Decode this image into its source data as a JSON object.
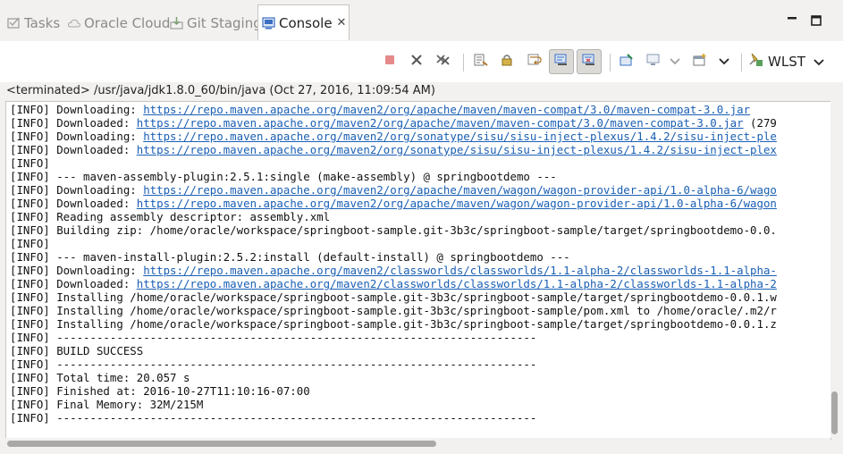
{
  "tabs": [
    {
      "label": "Tasks",
      "icon": "tasks-icon"
    },
    {
      "label": "Oracle Cloud",
      "icon": "cloud-icon"
    },
    {
      "label": "Git Staging",
      "icon": "git-staging-icon"
    },
    {
      "label": "Console",
      "icon": "console-icon",
      "active": true
    }
  ],
  "toolbar": {
    "wlst_label": "WLST",
    "accent_red": "#e05050",
    "accent_blue": "#3a6fc4"
  },
  "process_description": "<terminated> /usr/java/jdk1.8.0_60/bin/java (Oct 27, 2016, 11:09:54 AM)",
  "console": {
    "lines": [
      {
        "prefix": "[INFO] Downloading: ",
        "link": "https://repo.maven.apache.org/maven2/org/apache/maven/maven-compat/3.0/maven-compat-3.0.jar",
        "suffix": ""
      },
      {
        "prefix": "[INFO] Downloaded: ",
        "link": "https://repo.maven.apache.org/maven2/org/apache/maven/maven-compat/3.0/maven-compat-3.0.jar",
        "suffix": " (279"
      },
      {
        "prefix": "[INFO] Downloading: ",
        "link": "https://repo.maven.apache.org/maven2/org/sonatype/sisu/sisu-inject-plexus/1.4.2/sisu-inject-ple",
        "suffix": ""
      },
      {
        "prefix": "[INFO] Downloaded: ",
        "link": "https://repo.maven.apache.org/maven2/org/sonatype/sisu/sisu-inject-plexus/1.4.2/sisu-inject-plex",
        "suffix": ""
      },
      {
        "prefix": "[INFO]",
        "link": "",
        "suffix": ""
      },
      {
        "prefix": "[INFO] --- maven-assembly-plugin:2.5.1:single (make-assembly) @ springbootdemo ---",
        "link": "",
        "suffix": ""
      },
      {
        "prefix": "[INFO] Downloading: ",
        "link": "https://repo.maven.apache.org/maven2/org/apache/maven/wagon/wagon-provider-api/1.0-alpha-6/wago",
        "suffix": ""
      },
      {
        "prefix": "[INFO] Downloaded: ",
        "link": "https://repo.maven.apache.org/maven2/org/apache/maven/wagon/wagon-provider-api/1.0-alpha-6/wagon",
        "suffix": ""
      },
      {
        "prefix": "[INFO] Reading assembly descriptor: assembly.xml",
        "link": "",
        "suffix": ""
      },
      {
        "prefix": "[INFO] Building zip: /home/oracle/workspace/springboot-sample.git-3b3c/springboot-sample/target/springbootdemo-0.0.",
        "link": "",
        "suffix": ""
      },
      {
        "prefix": "[INFO]",
        "link": "",
        "suffix": ""
      },
      {
        "prefix": "[INFO] --- maven-install-plugin:2.5.2:install (default-install) @ springbootdemo ---",
        "link": "",
        "suffix": ""
      },
      {
        "prefix": "[INFO] Downloading: ",
        "link": "https://repo.maven.apache.org/maven2/classworlds/classworlds/1.1-alpha-2/classworlds-1.1-alpha-",
        "suffix": ""
      },
      {
        "prefix": "[INFO] Downloaded: ",
        "link": "https://repo.maven.apache.org/maven2/classworlds/classworlds/1.1-alpha-2/classworlds-1.1-alpha-2",
        "suffix": ""
      },
      {
        "prefix": "[INFO] Installing /home/oracle/workspace/springboot-sample.git-3b3c/springboot-sample/target/springbootdemo-0.0.1.w",
        "link": "",
        "suffix": ""
      },
      {
        "prefix": "[INFO] Installing /home/oracle/workspace/springboot-sample.git-3b3c/springboot-sample/pom.xml to /home/oracle/.m2/r",
        "link": "",
        "suffix": ""
      },
      {
        "prefix": "[INFO] Installing /home/oracle/workspace/springboot-sample.git-3b3c/springboot-sample/target/springbootdemo-0.0.1.z",
        "link": "",
        "suffix": ""
      },
      {
        "prefix": "[INFO] ------------------------------------------------------------------------",
        "link": "",
        "suffix": ""
      },
      {
        "prefix": "[INFO] BUILD SUCCESS",
        "link": "",
        "suffix": ""
      },
      {
        "prefix": "[INFO] ------------------------------------------------------------------------",
        "link": "",
        "suffix": ""
      },
      {
        "prefix": "[INFO] Total time: 20.057 s",
        "link": "",
        "suffix": ""
      },
      {
        "prefix": "[INFO] Finished at: 2016-10-27T11:10:16-07:00",
        "link": "",
        "suffix": ""
      },
      {
        "prefix": "[INFO] Final Memory: 32M/215M",
        "link": "",
        "suffix": ""
      },
      {
        "prefix": "[INFO] ------------------------------------------------------------------------",
        "link": "",
        "suffix": ""
      }
    ]
  }
}
